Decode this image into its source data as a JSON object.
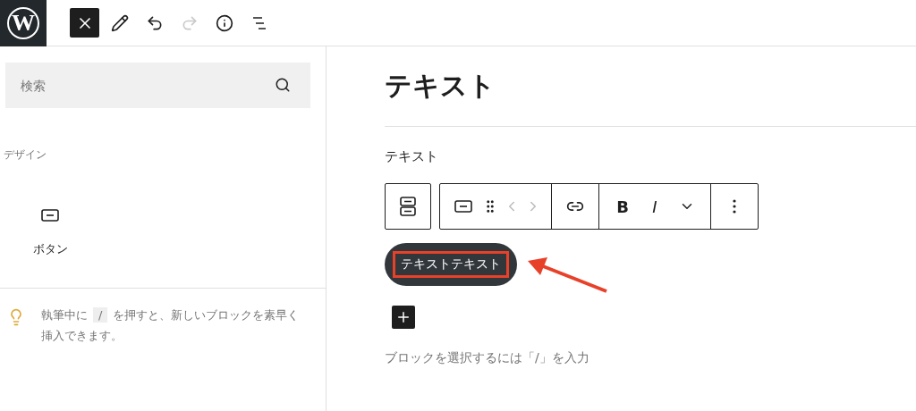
{
  "top_bar": {
    "logo": "W",
    "tools": [
      {
        "kind": "close",
        "selected": true,
        "disabled": false
      },
      {
        "kind": "pencil",
        "selected": false,
        "disabled": false
      },
      {
        "kind": "undo",
        "selected": false,
        "disabled": false
      },
      {
        "kind": "redo",
        "selected": false,
        "disabled": true
      },
      {
        "kind": "info",
        "selected": false,
        "disabled": false
      },
      {
        "kind": "list",
        "selected": false,
        "disabled": false
      }
    ]
  },
  "inserter": {
    "search": {
      "placeholder": "検索"
    },
    "category": "デザイン",
    "blocks": [
      {
        "label": "ボタン"
      }
    ],
    "tip": {
      "before": "執筆中に",
      "key": "/",
      "after": "を押すと、新しいブロックを素早く挿入できます。"
    }
  },
  "editor": {
    "title": "テキスト",
    "paragraph": "テキスト",
    "toolbar": [
      {
        "kind": "parent"
      },
      {
        "kind": "group",
        "items": [
          {
            "kind": "button"
          },
          {
            "kind": "drag"
          },
          {
            "kind": "move"
          }
        ]
      },
      {
        "kind": "group",
        "items": [
          {
            "kind": "link"
          }
        ]
      },
      {
        "kind": "group",
        "items": [
          {
            "kind": "bold"
          },
          {
            "kind": "italic"
          },
          {
            "kind": "more"
          }
        ]
      },
      {
        "kind": "group",
        "items": [
          {
            "kind": "options"
          }
        ]
      }
    ],
    "bold_label": "B",
    "italic_label": "I",
    "button_text": "テキストテキスト",
    "highlighted": true,
    "placeholder": "ブロックを選択するには「/」を入力"
  }
}
